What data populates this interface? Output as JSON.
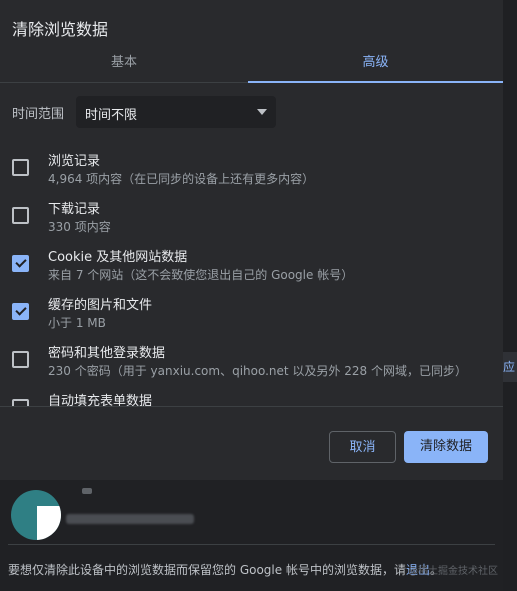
{
  "dialog": {
    "title": "清除浏览数据",
    "tabs": [
      {
        "label": "基本",
        "active": false
      },
      {
        "label": "高级",
        "active": true
      }
    ],
    "time_range": {
      "label": "时间范围",
      "selected": "时间不限"
    },
    "items": [
      {
        "name": "浏览记录",
        "desc": "4,964 项内容（在已同步的设备上还有更多内容）",
        "checked": false
      },
      {
        "name": "下载记录",
        "desc": "330 项内容",
        "checked": false
      },
      {
        "name": "Cookie 及其他网站数据",
        "desc": "来自 7 个网站（这不会致使您退出自己的 Google 帐号）",
        "checked": true
      },
      {
        "name": "缓存的图片和文件",
        "desc": "小于 1 MB",
        "checked": true
      },
      {
        "name": "密码和其他登录数据",
        "desc": "230 个密码（用于 yanxiu.com、qihoo.net 以及另外 228 个网域，已同步）",
        "checked": false
      },
      {
        "name": "自动填充表单数据",
        "desc": "",
        "checked": false
      }
    ],
    "buttons": {
      "cancel": "取消",
      "clear": "清除数据"
    },
    "footer": {
      "text": "要想仅清除此设备中的浏览数据而保留您的 Google 帐号中的浏览数据，请",
      "link": "退出",
      "end": "。"
    },
    "watermark": "@稀土掘金技术社区"
  },
  "colors": {
    "accent": "#8ab4f8",
    "background": "#292a2d",
    "text": "#e8eaed",
    "muted": "#9aa0a6"
  }
}
